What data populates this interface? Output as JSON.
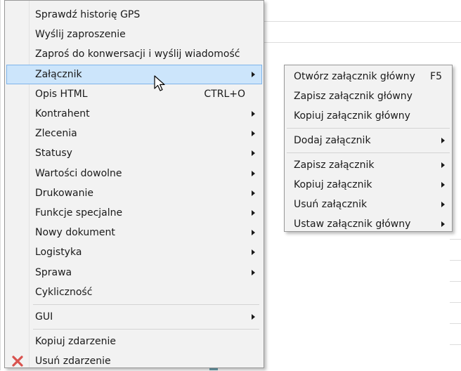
{
  "main_menu": {
    "items": [
      {
        "label": "Sprawdź historię GPS"
      },
      {
        "label": "Wyślij zaproszenie"
      },
      {
        "label": "Zaproś do konwersacji i wyślij wiadomość"
      },
      {
        "label": "Załącznik",
        "submenu": true,
        "highlighted": true
      },
      {
        "label": "Opis HTML",
        "shortcut": "CTRL+O"
      },
      {
        "label": "Kontrahent",
        "submenu": true
      },
      {
        "label": "Zlecenia",
        "submenu": true
      },
      {
        "label": "Statusy",
        "submenu": true
      },
      {
        "label": "Wartości dowolne",
        "submenu": true
      },
      {
        "label": "Drukowanie",
        "submenu": true
      },
      {
        "label": "Funkcje specjalne",
        "submenu": true
      },
      {
        "label": "Nowy dokument",
        "submenu": true
      },
      {
        "label": "Logistyka",
        "submenu": true
      },
      {
        "label": "Sprawa",
        "submenu": true
      },
      {
        "label": "Cykliczność"
      },
      {
        "label": "GUI",
        "submenu": true
      },
      {
        "label": "Kopiuj zdarzenie"
      },
      {
        "label": "Usuń zdarzenie",
        "icon": "delete-x-icon"
      }
    ]
  },
  "sub_menu": {
    "items": [
      {
        "label": "Otwórz załącznik główny",
        "shortcut": "F5"
      },
      {
        "label": "Zapisz załącznik główny"
      },
      {
        "label": "Kopiuj załącznik główny"
      },
      {
        "label": "Dodaj załącznik",
        "submenu": true
      },
      {
        "label": "Zapisz załącznik",
        "submenu": true
      },
      {
        "label": "Kopiuj załącznik",
        "submenu": true
      },
      {
        "label": "Usuń załącznik",
        "submenu": true
      },
      {
        "label": "Ustaw załącznik główny",
        "submenu": true
      }
    ]
  },
  "colors": {
    "highlight": "#cce5fb",
    "highlight_border": "#7eb4ea",
    "delete_icon": "#d9534f",
    "background_accent": "#6fa3b0"
  }
}
